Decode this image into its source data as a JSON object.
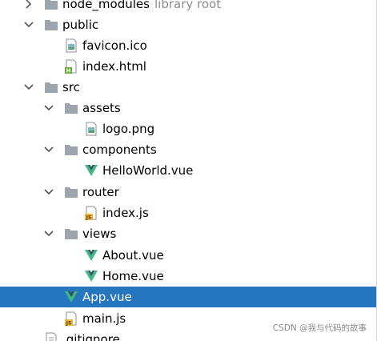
{
  "tree": {
    "items": [
      {
        "label": "node_modules",
        "extra": "library root"
      },
      {
        "label": "public"
      },
      {
        "label": "favicon.ico"
      },
      {
        "label": "index.html"
      },
      {
        "label": "src"
      },
      {
        "label": "assets"
      },
      {
        "label": "logo.png"
      },
      {
        "label": "components"
      },
      {
        "label": "HelloWorld.vue"
      },
      {
        "label": "router"
      },
      {
        "label": "index.js"
      },
      {
        "label": "views"
      },
      {
        "label": "About.vue"
      },
      {
        "label": "Home.vue"
      },
      {
        "label": "App.vue"
      },
      {
        "label": "main.js"
      },
      {
        "label": ".gitignore"
      }
    ]
  },
  "watermark": "CSDN @我与代码的故事",
  "colors": {
    "selection": "#2675bf",
    "folder": "#9ea4ac",
    "vue_green": "#41b883",
    "vue_dark": "#35495e",
    "js_yellow": "#f0b23e",
    "html_green": "#64a83b"
  }
}
